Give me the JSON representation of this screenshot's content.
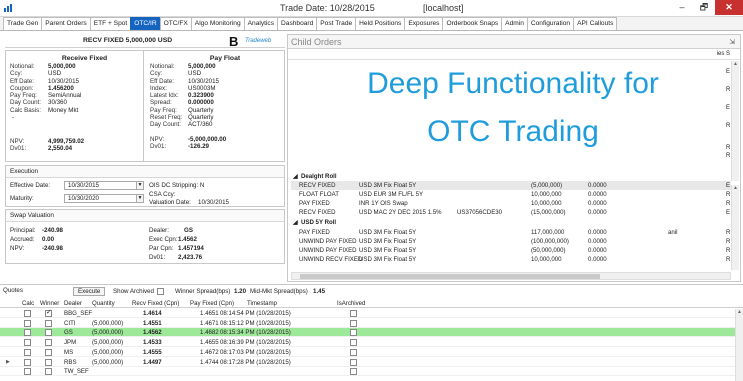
{
  "window": {
    "title": "Trade Date: 10/28/2015",
    "server": "[localhost]",
    "min": "–",
    "max": "🗗",
    "close": "✕"
  },
  "tabs": [
    {
      "label": "Trade Gen",
      "active": false
    },
    {
      "label": "Parent Orders",
      "active": false
    },
    {
      "label": "ETF + Spot",
      "active": false
    },
    {
      "label": "OTC/IR",
      "active": true
    },
    {
      "label": "OTC/FX",
      "active": false
    },
    {
      "label": "Algo Monitoring",
      "active": false
    },
    {
      "label": "Analytics",
      "active": false
    },
    {
      "label": "Dashboard",
      "active": false
    },
    {
      "label": "Post Trade",
      "active": false
    },
    {
      "label": "Held Positions",
      "active": false
    },
    {
      "label": "Exposures",
      "active": false
    },
    {
      "label": "Orderbook Snaps",
      "active": false
    },
    {
      "label": "Admin",
      "active": false
    },
    {
      "label": "Configuration",
      "active": false
    },
    {
      "label": "API Callouts",
      "active": false
    }
  ],
  "deal": {
    "title": "RECV FIXED 5,000,000 USD",
    "b_logo": "B",
    "tw_logo": "Tradeweb"
  },
  "leg_fixed": {
    "title": "Receive Fixed",
    "rows": [
      {
        "k": "Notional:",
        "v": "5,000,000",
        "bold": true
      },
      {
        "k": "Ccy:",
        "v": "USD",
        "bold": false
      },
      {
        "k": "Eff Date:",
        "v": "10/30/2015",
        "bold": false
      },
      {
        "k": "Coupon:",
        "v": "1.456200",
        "bold": true
      },
      {
        "k": "Pay Freq:",
        "v": "SemiAnnual",
        "bold": false
      },
      {
        "k": "Day Count:",
        "v": "30/360",
        "bold": false
      },
      {
        "k": "Calc Basis:",
        "v": "Money Mkt",
        "bold": false
      }
    ],
    "dash": "-",
    "npv_label": "NPV:",
    "npv": "4,999,759.02",
    "dv01_label": "Dv01:",
    "dv01": "2,550.04"
  },
  "leg_float": {
    "title": "Pay Float",
    "rows": [
      {
        "k": "Notional:",
        "v": "5,000,000",
        "bold": true
      },
      {
        "k": "Ccy:",
        "v": "USD",
        "bold": false
      },
      {
        "k": "Eff Date:",
        "v": "10/30/2015",
        "bold": false
      },
      {
        "k": "Index:",
        "v": "US0003M",
        "bold": false
      },
      {
        "k": "Latest Idx:",
        "v": "0.323900",
        "bold": true
      },
      {
        "k": "Spread:",
        "v": "0.000000",
        "bold": true
      },
      {
        "k": "Pay Freq:",
        "v": "Quarterly",
        "bold": false
      },
      {
        "k": "Reset Freq:",
        "v": "Quarterly",
        "bold": false
      },
      {
        "k": "Day Count:",
        "v": "ACT/360",
        "bold": false
      }
    ],
    "npv_label": "NPV:",
    "npv": "-5,000,000.00",
    "dv01_label": "Dv01:",
    "dv01": "-126.29"
  },
  "execution": {
    "label": "Execution",
    "eff_label": "Effective Date:",
    "eff_value": "10/30/2015",
    "mat_label": "Maturity:",
    "mat_value": "10/30/2020",
    "ois_label": "OIS DC Stripping: N",
    "csa_label": "CSA Ccy:",
    "val_label": "Valuation Date:",
    "val_value": "10/30/2015"
  },
  "swap_valuation": {
    "label": "Swap Valuation",
    "principal_label": "Principal:",
    "principal": "-240.98",
    "accrued_label": "Accrued:",
    "accrued": "0.00",
    "npv_label": "NPV:",
    "npv": "-240.98",
    "dealer_label": "Dealer:",
    "dealer": "GS",
    "exec_cpn_label": "Exec Cpn:",
    "exec_cpn": "1.4562",
    "par_cpn_label": "Par Cpn:",
    "par_cpn": "1.457194",
    "dv01_label": "Dv01:",
    "dv01": "2,423.76"
  },
  "child_orders": {
    "title": "Child Orders",
    "pin": "⇲",
    "ses_header": "ies  S",
    "group1": "Dealght Roll",
    "group2": "USD 5Y Roll",
    "rows_top": [
      {
        "type": "RECV FIXED",
        "desc": "USD 3M Fix Float 5Y",
        "cusip": "",
        "qty": "(5,000,000)",
        "px": "0.0000",
        "sts": "",
        "flag": "E",
        "shaded": true
      },
      {
        "type": "FLOAT FLOAT",
        "desc": "USD EUR 3M FL/FL 5Y",
        "cusip": "",
        "qty": "10,000,000",
        "px": "0.0000",
        "sts": "",
        "flag": "R",
        "shaded": false
      },
      {
        "type": "PAY FIXED",
        "desc": "INR 1Y OIS Swap",
        "cusip": "",
        "qty": "10,000,000",
        "px": "0.0000",
        "sts": "",
        "flag": "R",
        "shaded": false
      },
      {
        "type": "RECV FIXED",
        "desc": "USD MAC 2Y DEC 2015 1.5%",
        "cusip": "US37056CDE30",
        "qty": "(15,000,000)",
        "px": "0.0000",
        "sts": "",
        "flag": "E",
        "shaded": false
      }
    ],
    "rows_bottom": [
      {
        "type": "PAY FIXED",
        "desc": "USD 3M Fix Float 5Y",
        "cusip": "",
        "qty": "117,000,000",
        "px": "0.0000",
        "sts": "anil",
        "flag": "R",
        "shaded": false
      },
      {
        "type": "UNWIND PAY FIXED",
        "desc": "USD 3M Fix Float 5Y",
        "cusip": "",
        "qty": "(100,000,000)",
        "px": "0.0000",
        "sts": "",
        "flag": "R",
        "shaded": false
      },
      {
        "type": "UNWIND PAY FIXED",
        "desc": "USD 3M Fix Float 5Y",
        "cusip": "",
        "qty": "(50,000,000)",
        "px": "0.0000",
        "sts": "",
        "flag": "R",
        "shaded": false
      },
      {
        "type": "UNWIND RECV FIXED",
        "desc": "USD 3M Fix Float 5Y",
        "cusip": "",
        "qty": "10,000,000",
        "px": "0.0000",
        "sts": "",
        "flag": "R",
        "shaded": false
      }
    ],
    "right_flags": [
      "E",
      "R",
      "E",
      "R",
      "R",
      "R"
    ]
  },
  "overlay": {
    "line1": "Deep Functionality for",
    "line2": "OTC Trading"
  },
  "quotes": {
    "label": "Quotes",
    "execute": "Execute",
    "show_archived": "Show Archived",
    "winner_spread": "Winner Spread(bps)",
    "winner_spread_val": "1.20",
    "mid_spread": "Mid-Mkt Spread(bps)",
    "mid_spread_val": "1.45",
    "headers": [
      "Calc",
      "Winner",
      "Dealer",
      "Quantity",
      "Recv Fixed (Cpn)",
      "Pay Fixed (Cpn)",
      "Timestamp",
      "IsArchived"
    ],
    "rows": [
      {
        "calc": false,
        "winner": true,
        "dealer": "BBG_SEF",
        "qty": "",
        "recv": "1.4614",
        "pay": "1.4651",
        "ts": "08:14:54 PM (10/28/2015)",
        "hl": false,
        "sel": false
      },
      {
        "calc": false,
        "winner": false,
        "dealer": "CITI",
        "qty": "(5,000,000)",
        "recv": "1.4551",
        "pay": "1.4671",
        "ts": "08:15:12 PM (10/28/2015)",
        "hl": false,
        "sel": false
      },
      {
        "calc": false,
        "winner": false,
        "dealer": "GS",
        "qty": "(5,000,000)",
        "recv": "1.4562",
        "pay": "1.4682",
        "ts": "08:15:34 PM (10/28/2015)",
        "hl": true,
        "sel": false
      },
      {
        "calc": false,
        "winner": false,
        "dealer": "JPM",
        "qty": "(5,000,000)",
        "recv": "1.4533",
        "pay": "1.4655",
        "ts": "08:16:39 PM (10/28/2015)",
        "hl": false,
        "sel": false
      },
      {
        "calc": false,
        "winner": false,
        "dealer": "MS",
        "qty": "(5,000,000)",
        "recv": "1.4555",
        "pay": "1.4672",
        "ts": "08:17:03 PM (10/28/2015)",
        "hl": false,
        "sel": false
      },
      {
        "calc": false,
        "winner": false,
        "dealer": "RBS",
        "qty": "(5,000,000)",
        "recv": "1.4497",
        "pay": "1.4744",
        "ts": "08:17:28 PM (10/28/2015)",
        "hl": false,
        "sel": true
      },
      {
        "calc": false,
        "winner": false,
        "dealer": "TW_SEF",
        "qty": "",
        "recv": "",
        "pay": "",
        "ts": "",
        "hl": false,
        "sel": false
      }
    ]
  }
}
